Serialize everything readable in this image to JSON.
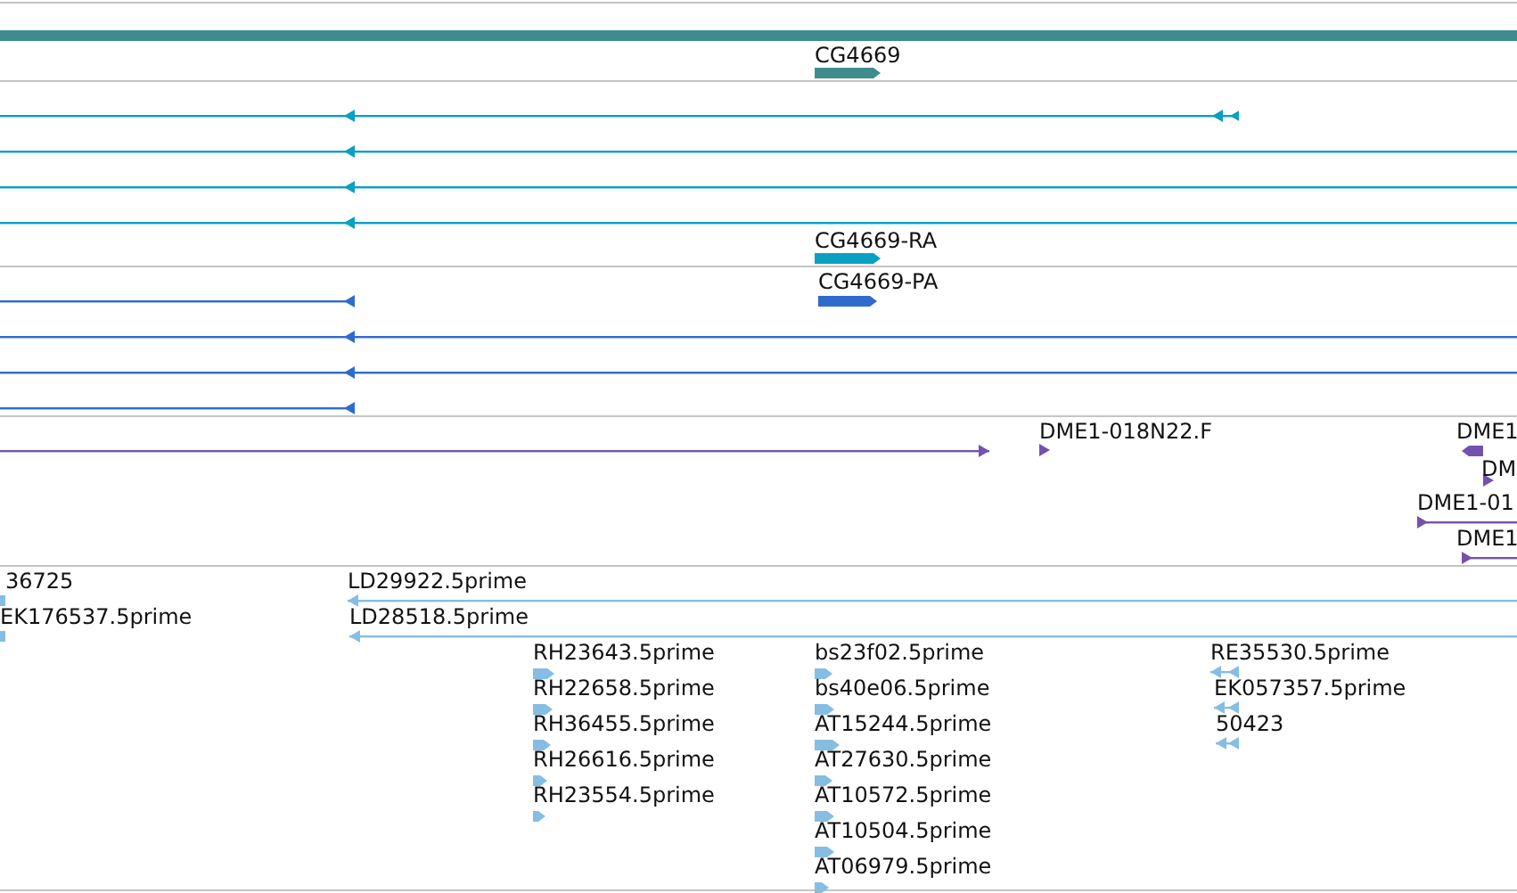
{
  "tracks": [
    {
      "color": "#3f8c8f",
      "features": [
        {
          "kind": "band"
        },
        {
          "kind": "bar",
          "reverse": false,
          "label": "CG4669"
        }
      ]
    },
    {
      "color": "#09a0c2",
      "features": [
        {
          "kind": "line",
          "reverse": true
        },
        {
          "kind": "line",
          "reverse": true
        },
        {
          "kind": "line",
          "reverse": true
        },
        {
          "kind": "line",
          "reverse": true
        },
        {
          "kind": "bar",
          "reverse": false,
          "label": "CG4669-RA"
        }
      ]
    },
    {
      "color": "#2f6bcc",
      "features": [
        {
          "kind": "bar",
          "reverse": false,
          "label": "CG4669-PA"
        },
        {
          "kind": "line",
          "reverse": true
        },
        {
          "kind": "line",
          "reverse": true
        },
        {
          "kind": "line",
          "reverse": true
        },
        {
          "kind": "line",
          "reverse": true
        }
      ]
    },
    {
      "color": "#7352ae",
      "features": [
        {
          "kind": "line",
          "reverse": false
        },
        {
          "kind": "tick",
          "reverse": false,
          "label": "DME1-018N22.F"
        },
        {
          "kind": "bar",
          "reverse": true,
          "label": "DME1"
        },
        {
          "kind": "tick",
          "reverse": false,
          "label": "DM"
        },
        {
          "kind": "line",
          "reverse": false,
          "label": "DME1-01"
        },
        {
          "kind": "line",
          "reverse": false,
          "label": "DME1"
        }
      ]
    },
    {
      "color": "#86bde2",
      "features": [
        {
          "kind": "band",
          "label": "36725"
        },
        {
          "kind": "band",
          "label": "EK176537.5prime"
        },
        {
          "kind": "line",
          "reverse": true,
          "label": "LD29922.5prime"
        },
        {
          "kind": "line",
          "reverse": true,
          "label": "LD28518.5prime"
        },
        {
          "kind": "bar",
          "reverse": false,
          "label": "RH23643.5prime"
        },
        {
          "kind": "bar",
          "reverse": false,
          "label": "RH22658.5prime"
        },
        {
          "kind": "bar",
          "reverse": false,
          "label": "RH36455.5prime"
        },
        {
          "kind": "bar",
          "reverse": false,
          "label": "RH26616.5prime"
        },
        {
          "kind": "bar",
          "reverse": false,
          "label": "RH23554.5prime"
        },
        {
          "kind": "bar",
          "reverse": false,
          "label": "bs23f02.5prime"
        },
        {
          "kind": "bar",
          "reverse": false,
          "label": "bs40e06.5prime"
        },
        {
          "kind": "bar",
          "reverse": false,
          "label": "AT15244.5prime"
        },
        {
          "kind": "bar",
          "reverse": false,
          "label": "AT27630.5prime"
        },
        {
          "kind": "bar",
          "reverse": false,
          "label": "AT10572.5prime"
        },
        {
          "kind": "bar",
          "reverse": false,
          "label": "AT10504.5prime"
        },
        {
          "kind": "bar",
          "reverse": false,
          "label": "AT06979.5prime"
        },
        {
          "kind": "line",
          "reverse": true,
          "label": "RE35530.5prime"
        },
        {
          "kind": "line",
          "reverse": true,
          "label": "EK057357.5prime"
        },
        {
          "kind": "line",
          "reverse": true,
          "label": "50423"
        }
      ]
    }
  ]
}
